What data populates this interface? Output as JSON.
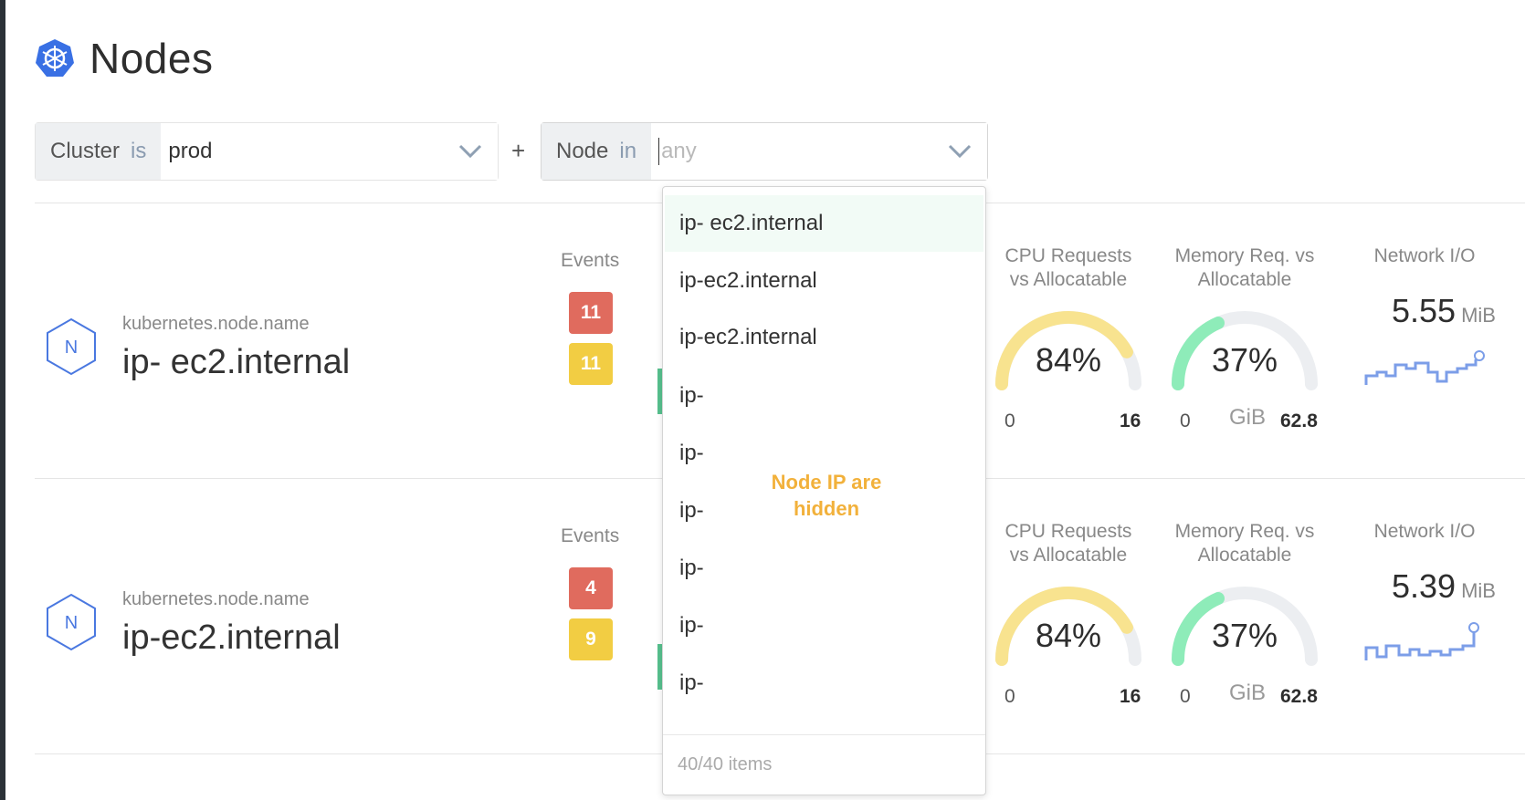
{
  "page": {
    "title": "Nodes",
    "logo_icon": "kubernetes-helm-icon"
  },
  "filters": {
    "cluster": {
      "key": "Cluster",
      "operator": "is",
      "value": "prod"
    },
    "plus": "+",
    "node": {
      "key": "Node",
      "operator": "in",
      "placeholder": "any"
    }
  },
  "nodes": [
    {
      "icon_letter": "N",
      "key_label": "kubernetes.node.name",
      "name": "ip- ec2.internal",
      "events_label": "Events",
      "events_error": "11",
      "events_warning": "11",
      "cpu": {
        "label_line1": "CPU Requests",
        "label_line2": "vs Allocatable",
        "percent": 84,
        "value_text": "84%",
        "min": "0",
        "max": "16"
      },
      "memory": {
        "label_line1": "Memory Req. vs",
        "label_line2": "Allocatable",
        "percent": 37,
        "value_text": "37%",
        "min": "0",
        "unit": "GiB",
        "max": "62.8"
      },
      "network": {
        "label": "Network I/O",
        "value": "5.55",
        "unit": "MiB"
      }
    },
    {
      "icon_letter": "N",
      "key_label": "kubernetes.node.name",
      "name": "ip-ec2.internal",
      "events_label": "Events",
      "events_error": "4",
      "events_warning": "9",
      "cpu": {
        "label_line1": "CPU Requests",
        "label_line2": "vs Allocatable",
        "percent": 84,
        "value_text": "84%",
        "min": "0",
        "max": "16"
      },
      "memory": {
        "label_line1": "Memory Req. vs",
        "label_line2": "Allocatable",
        "percent": 37,
        "value_text": "37%",
        "min": "0",
        "unit": "GiB",
        "max": "62.8"
      },
      "network": {
        "label": "Network I/O",
        "value": "5.39",
        "unit": "MiB"
      }
    }
  ],
  "dropdown": {
    "items": [
      "ip- ec2.internal",
      "ip-ec2.internal",
      "ip-ec2.internal",
      "ip-",
      "ip-",
      "ip-",
      "ip-",
      "ip-",
      "ip-"
    ],
    "footer": "40/40 items"
  },
  "annotation": {
    "line1": "Node IP are",
    "line2": "hidden"
  },
  "colors": {
    "accent": "#3970e4",
    "error": "#e06b5e",
    "warning": "#f2cd43",
    "cpu_gauge": "#f8e38f",
    "mem_gauge": "#8eecb9",
    "gauge_track": "#eceef1",
    "sparkline": "#7c9ee8",
    "note": "#f2b13b"
  }
}
